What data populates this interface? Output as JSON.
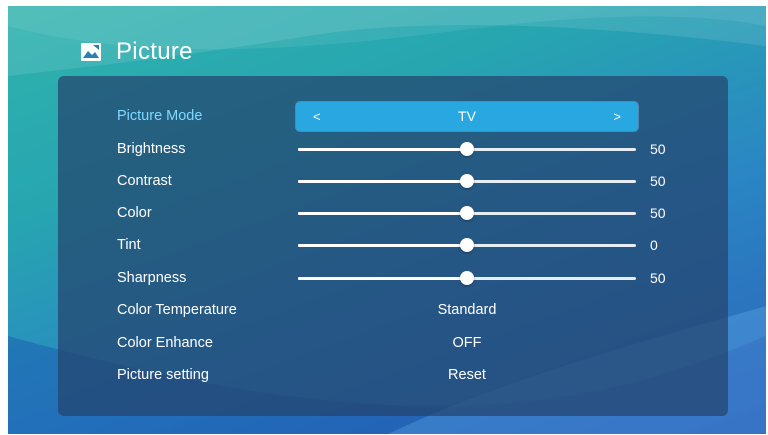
{
  "header": {
    "title": "Picture",
    "icon": "picture-icon"
  },
  "colors": {
    "accent": "#28a7e0",
    "active_label": "#7fd9ff",
    "panel": "#24446e"
  },
  "picture_mode": {
    "label": "Picture Mode",
    "value": "TV",
    "prev": "<",
    "next": ">"
  },
  "sliders": [
    {
      "label": "Brightness",
      "value": "50",
      "level": 0.5
    },
    {
      "label": "Contrast",
      "value": "50",
      "level": 0.5
    },
    {
      "label": "Color",
      "value": "50",
      "level": 0.5
    },
    {
      "label": "Tint",
      "value": "0",
      "level": 0.5
    },
    {
      "label": "Sharpness",
      "value": "50",
      "level": 0.5
    }
  ],
  "options": [
    {
      "label": "Color Temperature",
      "value": "Standard"
    },
    {
      "label": "Color Enhance",
      "value": "OFF"
    },
    {
      "label": "Picture setting",
      "value": "Reset"
    }
  ]
}
